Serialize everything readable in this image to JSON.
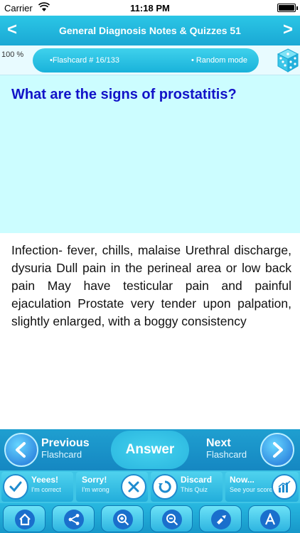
{
  "status": {
    "carrier": "Carrier",
    "time": "11:18 PM"
  },
  "nav": {
    "back": "<",
    "title": "General Diagnosis Notes & Quizzes 51",
    "forward": ">"
  },
  "info": {
    "progress": "100 %",
    "flashcard_label": "•Flashcard #  16/133",
    "random_label": "• Random mode"
  },
  "question": "What are the signs of prostatitis?",
  "answer": "Infection- fever, chills, malaise Urethral discharge, dysuria Dull pain in the perineal area or low back pain May have testicular pain and painful ejaculation Prostate very tender upon palpation, slightly enlarged, with a boggy consistency",
  "controls": {
    "previous": {
      "big": "Previous",
      "small": "Flashcard"
    },
    "answer_label": "Answer",
    "next": {
      "big": "Next",
      "small": "Flashcard"
    },
    "yes": {
      "label": "Yeees!",
      "sub": "I'm correct"
    },
    "sorry": {
      "label": "Sorry!",
      "sub": "I'm wrong"
    },
    "discard": {
      "label": "Discard",
      "sub": "This Quiz"
    },
    "now": {
      "label": "Now...",
      "sub": "See your score"
    }
  },
  "toolbar": {
    "icons": [
      "home-icon",
      "share-icon",
      "zoom-in-icon",
      "zoom-out-icon",
      "settings-icon",
      "font-icon"
    ]
  },
  "colors": {
    "nav_bg": "#1aa8d4",
    "question_bg": "#ccfdff",
    "question_text": "#1212c8"
  }
}
